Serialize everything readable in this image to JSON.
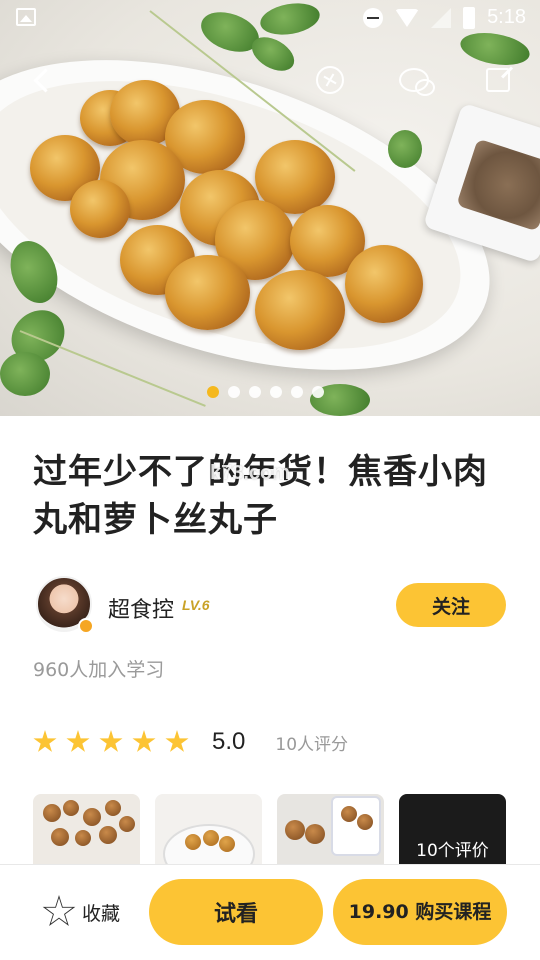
{
  "status_bar": {
    "time": "5:18"
  },
  "hero": {
    "carousel_count": 6,
    "carousel_active": 0,
    "accent_color": "#f5b81e"
  },
  "course": {
    "title": "过年少不了的年货！焦香小肉丸和萝卜丝丸子",
    "watermark": "k73.com"
  },
  "author": {
    "name": "超食控",
    "level": "LV.6",
    "follow_label": "关注"
  },
  "learners_text": "960人加入学习",
  "rating": {
    "stars": 5,
    "score": "5.0",
    "count_text": "10人评分"
  },
  "reviews": {
    "more_label": "10个评价"
  },
  "bottom_bar": {
    "collect_label": "收藏",
    "trial_label": "试看",
    "buy_label": "19.90 购买课程"
  },
  "colors": {
    "primary": "#fcc434",
    "level": "#c9a227",
    "muted_text": "#9a9a9a"
  }
}
